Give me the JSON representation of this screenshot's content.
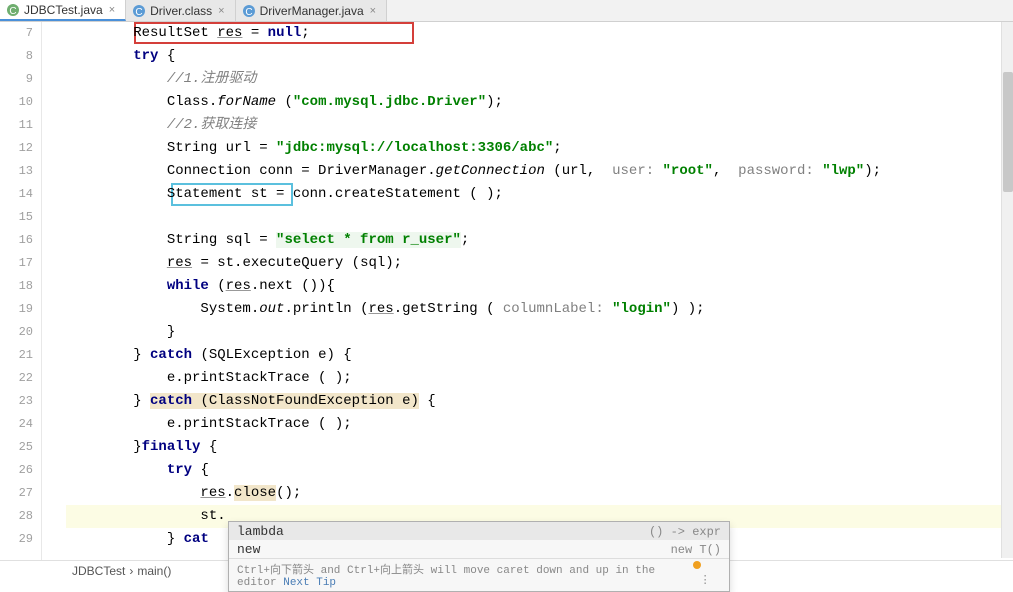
{
  "tabs": [
    {
      "label": "JDBCTest.java",
      "active": true,
      "icon": "C"
    },
    {
      "label": "Driver.class",
      "active": false,
      "icon": "C"
    },
    {
      "label": "DriverManager.java",
      "active": false,
      "icon": "C"
    }
  ],
  "gutter": [
    "7",
    "8",
    "9",
    "10",
    "11",
    "12",
    "13",
    "14",
    "15",
    "16",
    "17",
    "18",
    "19",
    "20",
    "21",
    "22",
    "23",
    "24",
    "25",
    "26",
    "27",
    "28",
    "29"
  ],
  "code": {
    "l7_a": "ResultSet ",
    "l7_b": "res",
    "l7_c": " = ",
    "l7_d": "null",
    "l7_e": ";",
    "l8_a": "try",
    "l8_b": " {",
    "l9": "//1.注册驱动",
    "l10_a": "Class.",
    "l10_b": "forName",
    "l10_c": " (",
    "l10_d": "\"com.mysql.jdbc.Driver\"",
    "l10_e": ");",
    "l11": "//2.获取连接",
    "l12_a": "String url = ",
    "l12_b": "\"jdbc:mysql://localhost:3306/abc\"",
    "l12_c": ";",
    "l13_a": "Connection conn = DriverManager.",
    "l13_b": "getConnection",
    "l13_c": " (url,  ",
    "l13_d": "user: ",
    "l13_e": "\"root\"",
    "l13_f": ",  ",
    "l13_g": "password: ",
    "l13_h": "\"lwp\"",
    "l13_i": ");",
    "l14_a": " Statement st ",
    "l14_b": "= conn.createStatement ( );",
    "l15": "",
    "l16_a": "String sql = ",
    "l16_b": "\"select * from r_user\"",
    "l16_c": ";",
    "l17_a": "res",
    "l17_b": " = st.executeQuery (sql);",
    "l18_a": "while",
    "l18_b": " (",
    "l18_c": "res",
    "l18_d": ".next ()){",
    "l19_a": "System.",
    "l19_b": "out",
    "l19_c": ".println (",
    "l19_d": "res",
    "l19_e": ".getString ( ",
    "l19_f": "columnLabel: ",
    "l19_g": "\"login\"",
    "l19_h": ") );",
    "l20": "}",
    "l21_a": "} ",
    "l21_b": "catch",
    "l21_c": " (SQLException e) {",
    "l22": "e.printStackTrace ( );",
    "l23_a": "} ",
    "l23_b": "catch",
    "l23_c": " (ClassNotFoundException e)",
    "l23_d": " {",
    "l24": "e.printStackTrace ( );",
    "l25_a": "}",
    "l25_b": "finally",
    "l25_c": " {",
    "l26_a": "try",
    "l26_b": " {",
    "l27_a": "res",
    "l27_b": ".",
    "l27_c": "close",
    "l27_d": "();",
    "l28": "st.",
    "l29_a": "} ",
    "l29_b": "cat"
  },
  "autocomplete": {
    "items": [
      {
        "left": "lambda",
        "right": "() -> expr"
      },
      {
        "left": "new",
        "right": "new T()"
      }
    ],
    "hint_pre": "Ctrl+向下箭头 and Ctrl+向上箭头 will move caret down and up in the editor ",
    "hint_link": "Next Tip"
  },
  "breadcrumb": {
    "a": "JDBCTest",
    "sep": "›",
    "b": "main()"
  }
}
